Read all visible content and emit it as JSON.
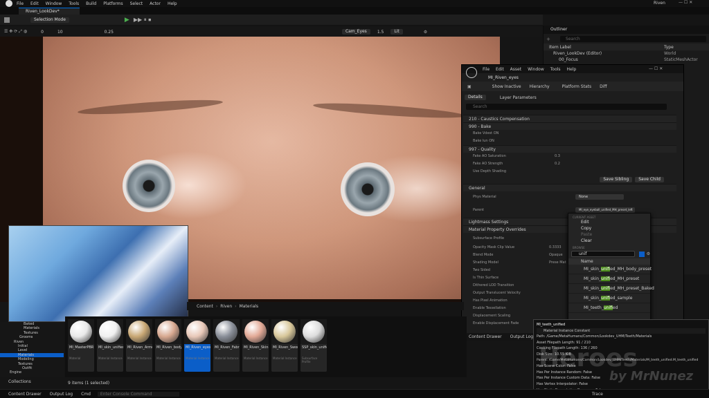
{
  "menubar": {
    "items": [
      "File",
      "Edit",
      "Window",
      "Tools",
      "Build",
      "Platforms",
      "Select",
      "Actor",
      "Help"
    ],
    "project": "Riven"
  },
  "level_tab": "Riven_LookDev*",
  "toolbar": {
    "mode": "Selection Mode"
  },
  "viewport": {
    "camera": "Cam_Eyes",
    "speed": "1.5",
    "lit": "Lit",
    "fov_a": "0",
    "fov_b": "10",
    "grid": "0.25"
  },
  "outliner": {
    "title": "Outliner",
    "search_placeholder": "Search",
    "col_label": "Item Label",
    "col_type": "Type",
    "rows": [
      {
        "label": "Riven_LookDev (Editor)",
        "type": "World"
      },
      {
        "label": "00_Focus",
        "type": "StaticMeshActor"
      }
    ]
  },
  "mated": {
    "menus": [
      "File",
      "Edit",
      "Asset",
      "Window",
      "Tools",
      "Help"
    ],
    "title": "MI_Riven_eyes",
    "tools": [
      "Show Inactive",
      "Hierarchy",
      "Platform Stats",
      "Diff"
    ],
    "tab_details": "Details",
    "tab_layers": "Layer Parameters",
    "search_placeholder": "Search",
    "groups": [
      "210 - Caustics Compensation",
      "990 - Bake",
      "997 - Quality"
    ],
    "bake_props": [
      "Bake Vdest ON",
      "Bake lun ON"
    ],
    "quality_props": [
      "Fake AO Saturation",
      "Fake AO Strength",
      "Use Depth Shading"
    ],
    "quality_vals": [
      "0.3",
      "0.2"
    ],
    "save_sibling": "Save Sibling",
    "save_child": "Save Child",
    "general": "General",
    "phys_label": "Phys Material",
    "phys_val": "None",
    "parent_label": "Parent",
    "parent_val": "MI_eye_eyeball_unified_MH_preset_left",
    "lightmass": "Lightmass Settings",
    "mpo": "Material Property Overrides",
    "mpo_props": [
      "Subsurface Profile",
      "Opacity Mask Clip Value",
      "Blend Mode",
      "Shading Model",
      "Two Sided",
      "Is Thin Surface",
      "Dithered LOD Transition",
      "Output Translucent Velocity",
      "Has Pixel Animation",
      "Enable Tessellation",
      "Displacement Scaling",
      "Enable Displacement Fade"
    ],
    "mpo_vals": [
      "0.3333",
      "Opaque",
      "Prese Mat"
    ],
    "content_drawer": "Content Drawer",
    "output_log": "Output Log"
  },
  "ctxmenu": {
    "section_current": "CURRENT ASSET",
    "edit": "Edit",
    "copy": "Copy",
    "paste": "Paste",
    "clear": "Clear",
    "section_browse": "BROWSE",
    "search_value": "unif",
    "col_name": "Name",
    "results": [
      {
        "pre": "MI_skin_",
        "hl": "unif",
        "post": "ied_MH_body_preset"
      },
      {
        "pre": "MI_skin_",
        "hl": "unif",
        "post": "ied_MH_preset"
      },
      {
        "pre": "MI_skin_",
        "hl": "unif",
        "post": "ied_MH_preset_Baked"
      },
      {
        "pre": "MI_skin_",
        "hl": "unif",
        "post": "ied_sample"
      },
      {
        "pre": "MI_teeth_",
        "hl": "unif",
        "post": "ied"
      }
    ]
  },
  "tooltip": {
    "name": "MI_teeth_unified",
    "class": "Material Instance Constant",
    "lines": [
      "Path: /Game/MetaHumans/Common/Lookdev_UHM/Teeth/Materials",
      "Asset Filepath Length: 91 / 210",
      "Cooking Filepath Length: 136 / 260",
      "Disk Size: 10.55 KiB",
      "Parent: /Game/MetaHumans/Common/Lookdev_UHM/Teeth/Materials/M_teeth_unified.M_teeth_unified",
      "Has Scene Color: False",
      "Has Per Instance Random: False",
      "Has Per Instance Custom Data: False",
      "Has Vertex Interpolator: False",
      "Has Static Permutation Resource: False"
    ]
  },
  "content": {
    "breadcrumb": [
      "Content",
      "Riven",
      "Materials"
    ],
    "count": "9 items (1 selected)",
    "tiles": [
      {
        "name": "MI_MasterPBR",
        "type": "Material",
        "ball": "#e9e9e9"
      },
      {
        "name": "MI_skin_unified_sk_mod",
        "type": "Material Instance",
        "ball": "#f0f0f0"
      },
      {
        "name": "MI_Riven_Armor",
        "type": "Material Instance",
        "ball": "#c8a774"
      },
      {
        "name": "MI_Riven_body",
        "type": "Material Instance",
        "ball": "#d7a890"
      },
      {
        "name": "MI_Riven_eyes",
        "type": "Material Instance",
        "ball": "#e8c8b8"
      },
      {
        "name": "MI_Riven_Fabric",
        "type": "Material Instance",
        "ball": "#8a8f99"
      },
      {
        "name": "MI_Riven_Skin",
        "type": "Material Instance",
        "ball": "#e2a996"
      },
      {
        "name": "MI_Riven_Sword",
        "type": "Material Instance",
        "ball": "#d8c79a"
      },
      {
        "name": "SSP_skin_unified_mod",
        "type": "Subsurface Profile",
        "ball": "#dddddd"
      }
    ],
    "tree": [
      "Baked",
      "Materials",
      "Textures",
      "Grooms",
      "Riven",
      "Initial",
      "Level",
      "Materials",
      "Modeling",
      "Textures",
      "Outfit",
      "Engine"
    ],
    "collections": "Collections"
  },
  "status": {
    "content_drawer": "Content Drawer",
    "output_log": "Output Log",
    "cmd": "Cmd",
    "console_placeholder": "Enter Console Command",
    "trace": "Trace"
  },
  "watermark": {
    "line1": "Heroes",
    "line2": "by MrNunez"
  }
}
